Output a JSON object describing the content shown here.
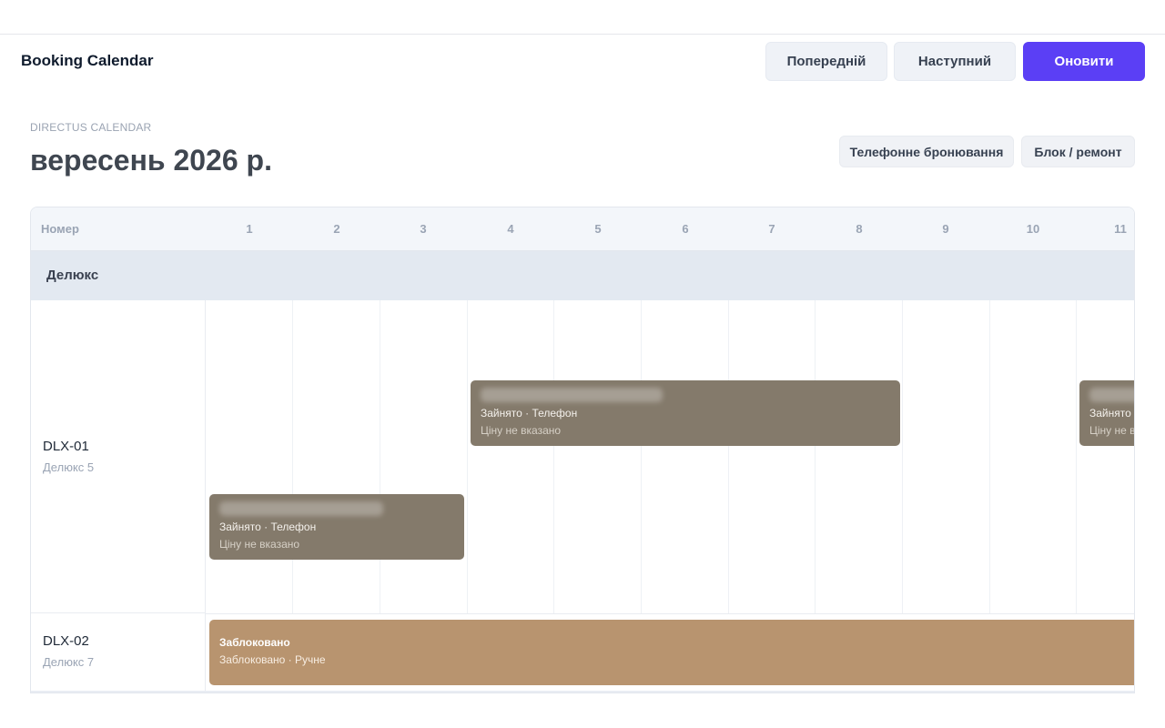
{
  "header": {
    "title": "Booking Calendar",
    "prev_label": "Попередній",
    "next_label": "Наступний",
    "refresh_label": "Оновити"
  },
  "page": {
    "subtitle": "DIRECTUS CALENDAR",
    "month": "вересень 2026 р.",
    "phone_booking_label": "Телефонне бронювання",
    "block_label": "Блок / ремонт"
  },
  "calendar": {
    "room_header": "Номер",
    "days": [
      "1",
      "2",
      "3",
      "4",
      "5",
      "6",
      "7",
      "8",
      "9",
      "10",
      "11"
    ],
    "group": "Делюкс",
    "rooms": [
      {
        "code": "DLX-01",
        "type": "Делюкс 5"
      },
      {
        "code": "DLX-02",
        "type": "Делюкс 7"
      }
    ],
    "bookings": [
      {
        "status": "Зайнято · Телефон",
        "price": "Ціну не вказано"
      },
      {
        "status": "Зайнято · Телефон",
        "price": "Ціну не вказано"
      },
      {
        "status": "Зайнято · Телефон",
        "price": "Ціну не вказано"
      }
    ],
    "block": {
      "title": "Заблоковано",
      "sub": "Заблоковано · Ручне"
    }
  },
  "colors": {
    "accent": "#5b3ff5",
    "booking": "#847a6b",
    "blocked": "#b8946f"
  }
}
